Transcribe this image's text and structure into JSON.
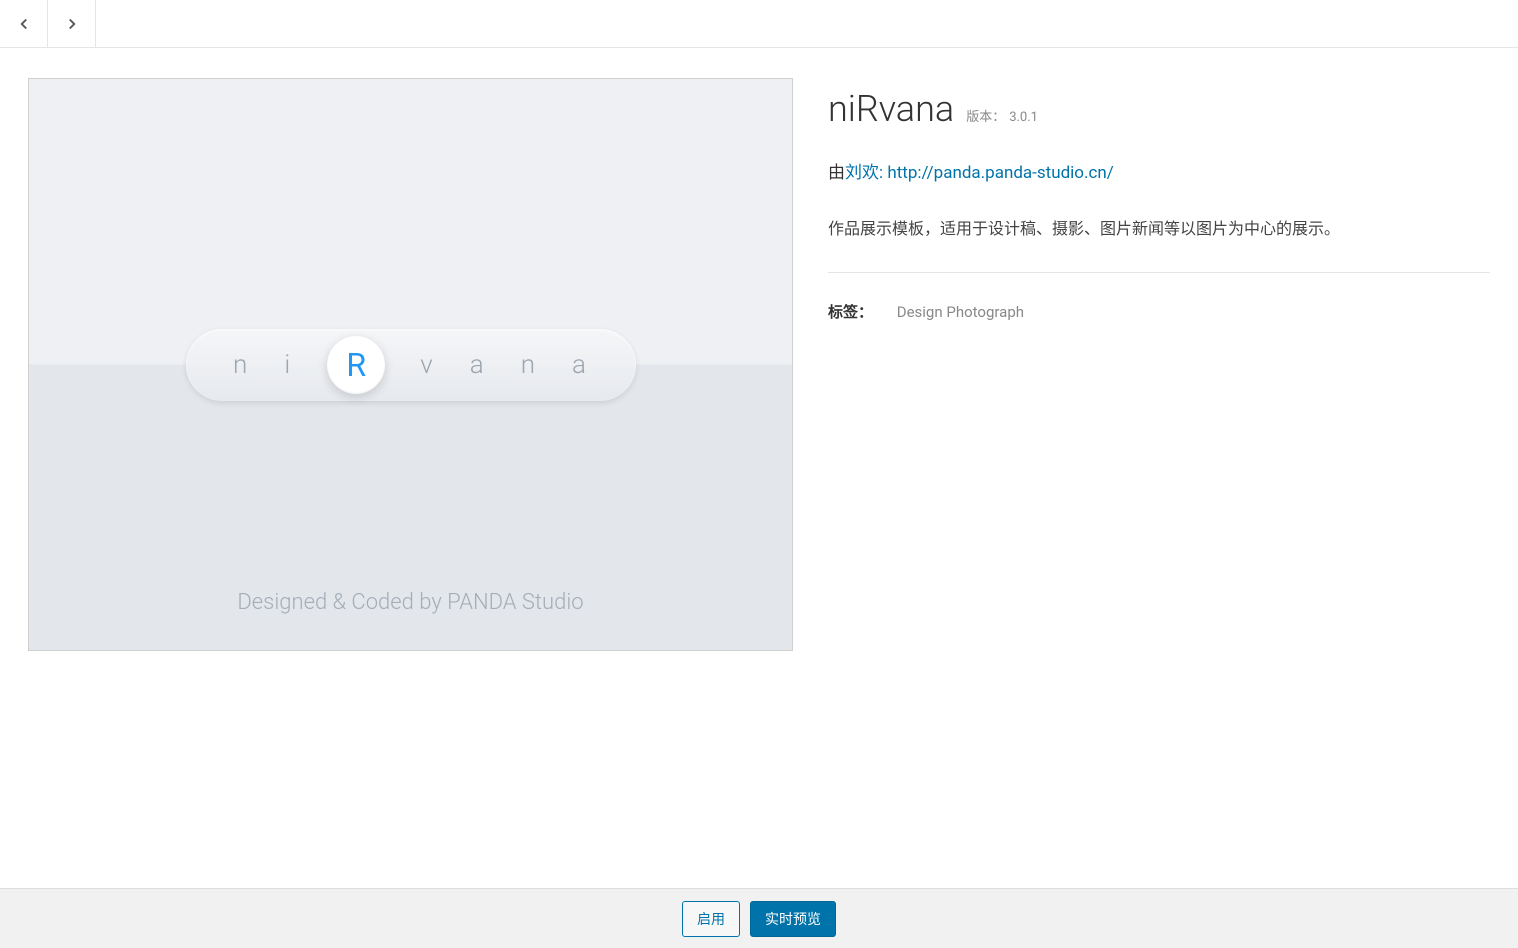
{
  "theme": {
    "name": "niRvana",
    "version_label": "版本：",
    "version": "3.0.1",
    "author_prefix": "由",
    "author_name": "刘欢",
    "author_url": ": http://panda.panda-studio.cn/",
    "description": "作品展示模板，适用于设计稿、摄影、图片新闻等以图片为中心的展示。",
    "tags_label": "标签：",
    "tags": "Design Photograph"
  },
  "preview": {
    "letters": [
      "n",
      "i",
      "R",
      "v",
      "a",
      "n",
      "a"
    ],
    "credit": "Designed & Coded by PANDA Studio"
  },
  "footer": {
    "activate": "启用",
    "live_preview": "实时预览"
  }
}
